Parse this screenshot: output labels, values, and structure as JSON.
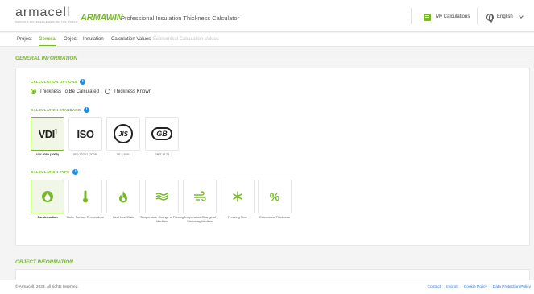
{
  "header": {
    "logo_text": "armacell",
    "logo_tagline": "MAKING A DIFFERENCE AROUND THE WORLD",
    "brand": "ARMAWIN",
    "title": "Professional Insulation Thickness Calculator",
    "my_calculations": "My Calculations",
    "language": "English"
  },
  "tabs": [
    {
      "label": "Project"
    },
    {
      "label": "General"
    },
    {
      "label": "Object"
    },
    {
      "label": "Insulation"
    },
    {
      "label": "Calculation Values"
    },
    {
      "label": "Economical Calculation Values"
    }
  ],
  "general": {
    "heading": "GENERAL INFORMATION",
    "calc_options": {
      "label": "CALCULATION OPTIONS",
      "options": [
        "Thickness To Be Calculated",
        "Thickness Known"
      ]
    },
    "calc_standard": {
      "label": "CALCULATION STANDARD",
      "items": [
        {
          "mark": "VDI",
          "caption": "VDI 2055 (2009)"
        },
        {
          "mark": "ISO",
          "caption": "ISO 12241 (2008)"
        },
        {
          "mark": "JIS",
          "caption": "JIS A 9501"
        },
        {
          "mark": "GB",
          "caption": "GB/T 8175"
        }
      ]
    },
    "calc_type": {
      "label": "CALCULATION TYPE",
      "items": [
        {
          "caption": "Condensation"
        },
        {
          "caption": "Outer Surface Temperature"
        },
        {
          "caption": "Heat Loss/Gain"
        },
        {
          "caption": "Temperature Change of Flowing Medium"
        },
        {
          "caption": "Temperature Change of Stationary Medium"
        },
        {
          "caption": "Freezing Time"
        },
        {
          "caption": "Economical Thickness"
        }
      ]
    }
  },
  "object": {
    "heading": "OBJECT INFORMATION"
  },
  "footer": {
    "copyright": "© Armacell, 2023. All rights reserved.",
    "links": [
      "Contact",
      "Imprint",
      "Cookie Policy",
      "Data Protection Policy"
    ]
  },
  "colors": {
    "accent": "#77b82a",
    "info": "#1e8fe1",
    "link": "#2a7ad4"
  }
}
